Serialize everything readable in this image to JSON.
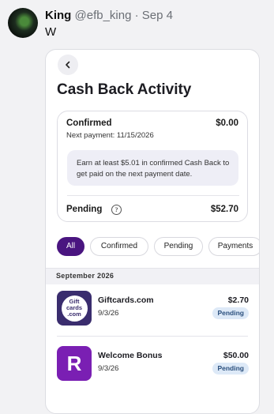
{
  "tweet": {
    "name": "King",
    "handle": "@efb_king",
    "separator": "·",
    "date": "Sep 4",
    "text": "W"
  },
  "screen": {
    "title": "Cash Back Activity",
    "summary": {
      "confirmed_label": "Confirmed",
      "confirmed_amount": "$0.00",
      "next_payment": "Next payment: 11/15/2026",
      "info_text": "Earn at least $5.01 in confirmed Cash Back to get paid on the next payment date.",
      "pending_label": "Pending",
      "pending_amount": "$52.70"
    },
    "filters": [
      "All",
      "Confirmed",
      "Pending",
      "Payments"
    ],
    "active_filter": "All",
    "month": "September 2026",
    "transactions": [
      {
        "logo_text": "Gift cards .com",
        "name": "Giftcards.com",
        "date": "9/3/26",
        "amount": "$2.70",
        "status": "Pending"
      },
      {
        "logo_text": "R",
        "name": "Welcome Bonus",
        "date": "9/3/26",
        "amount": "$50.00",
        "status": "Pending"
      }
    ]
  },
  "colors": {
    "accent": "#4a1580",
    "badge_bg": "#dde9f7",
    "giftcards_logo": "#3a2d6e",
    "rakuten_logo": "#7a1fb3"
  },
  "icons": [
    "back-chevron-icon",
    "info-icon"
  ]
}
